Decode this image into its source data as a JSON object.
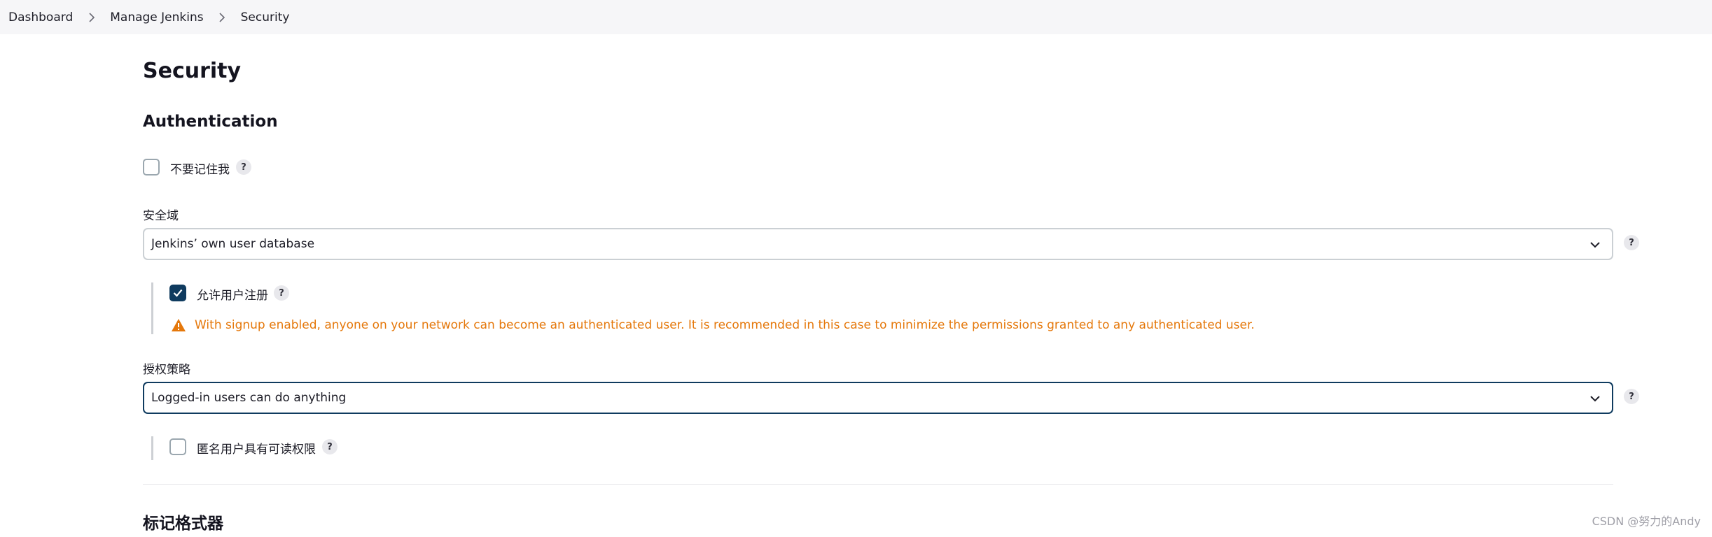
{
  "breadcrumb": {
    "items": [
      "Dashboard",
      "Manage Jenkins",
      "Security"
    ]
  },
  "page": {
    "title": "Security"
  },
  "authentication": {
    "heading": "Authentication",
    "dont_remember_me": {
      "label": "不要记住我",
      "checked": false
    },
    "security_realm": {
      "label": "安全域",
      "value": "Jenkins’ own user database"
    },
    "allow_signup": {
      "label": "允许用户注册",
      "checked": true
    },
    "signup_warning": "With signup enabled, anyone on your network can become an authenticated user. It is recommended in this case to minimize the permissions granted to any authenticated user.",
    "authorization_strategy": {
      "label": "授权策略",
      "value": "Logged-in users can do anything"
    },
    "anonymous_read": {
      "label": "匿名用户具有可读权限",
      "checked": false
    }
  },
  "markup_formatter": {
    "heading": "标记格式器"
  },
  "help_icon_text": "?",
  "watermark": "CSDN @努力的Andy",
  "colors": {
    "accent": "#0f3b5f",
    "warning": "#e5780b",
    "topbar_bg": "#f6f6f8"
  }
}
